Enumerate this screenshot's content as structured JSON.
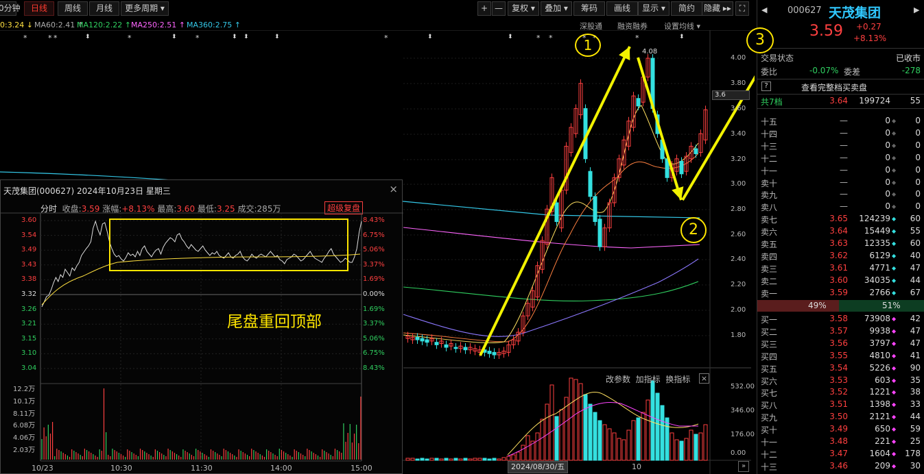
{
  "toolbar": {
    "left": [
      "0分钟",
      "日线",
      "周线",
      "月线",
      "更多周期 ▾"
    ],
    "right": [
      "+",
      "—",
      "复权 ▾",
      "叠加 ▾",
      "筹码",
      "画线",
      "显示 ▾",
      "简约",
      "隐藏 ▸▸"
    ]
  },
  "ma_line": [
    {
      "label": "0:3.24 ↓",
      "color": "#ffe040"
    },
    {
      "label": "MA60:2.41 ↑",
      "color": "#aaaaaa"
    },
    {
      "label": "MA120:2.22 ↑",
      "color": "#30d060"
    },
    {
      "label": "MA250:2.51 ↑",
      "color": "#ff66ff"
    },
    {
      "label": "MA360:2.75 ↑",
      "color": "#34c8e8"
    }
  ],
  "top_links": [
    "深股通",
    "融资融券",
    "设置均线 ▾"
  ],
  "main_chart": {
    "y_ticks": [
      "4.00",
      "3.80",
      "3.60",
      "3.40",
      "3.20",
      "3.00",
      "2.80",
      "2.60",
      "2.40",
      "2.20",
      "2.00",
      "1.80"
    ],
    "price_tag": "3.6",
    "high_label": "4.08",
    "date_label": "2024/08/30/五",
    "x_tick": "10",
    "annotations": [
      "1",
      "2",
      "3"
    ],
    "vol_header": [
      "改参数",
      "加指标",
      "换指标"
    ],
    "vol_ticks": [
      "532.00",
      "346.00",
      "176.00",
      "0.00"
    ]
  },
  "overlay": {
    "title": "天茂集团(000627) 2024年10月23日 星期三",
    "stats": {
      "label_fs": "分时",
      "close_k": "收盘:",
      "close_v": "3.59",
      "chg_k": "涨幅:",
      "chg_v": "+8.13%",
      "high_k": "最高:",
      "high_v": "3.60",
      "low_k": "最低:",
      "low_v": "3.25",
      "vol_k": "成交:",
      "vol_v": "285万"
    },
    "super": "超级复盘",
    "left_ticks": [
      "3.60",
      "3.54",
      "3.49",
      "3.43",
      "3.38",
      "3.32",
      "3.26",
      "3.21",
      "3.15",
      "3.10",
      "3.04"
    ],
    "right_ticks": [
      "8.43%",
      "6.75%",
      "5.06%",
      "3.37%",
      "1.69%",
      "0.00%",
      "1.69%",
      "3.37%",
      "5.06%",
      "6.75%",
      "8.43%"
    ],
    "vol_ticks": [
      "12.2万",
      "10.1万",
      "8.11万",
      "6.08万",
      "4.06万",
      "2.03万"
    ],
    "x_ticks": [
      "10/23",
      "10:30",
      "11:30",
      "14:00",
      "15:00"
    ],
    "annotation": "尾盘重回顶部",
    "close_icon": "×"
  },
  "orderbook": {
    "code": "000627",
    "name": "天茂集团",
    "price": "3.59",
    "change": "+0.27",
    "pct": "+8.13%",
    "status_k": "交易状态",
    "status_v": "已收市",
    "weibi_k": "委比",
    "weibi_v": "-0.07%",
    "weicha_k": "委差",
    "weicha_v": "-278",
    "full_link": "查看完整档买卖盘",
    "total": {
      "label": "共7档",
      "price": "3.64",
      "vol": "199724",
      "cnt": "55"
    },
    "sells": [
      {
        "label": "十五",
        "price": "—",
        "vol": "0",
        "cnt": "0"
      },
      {
        "label": "十四",
        "price": "—",
        "vol": "0",
        "cnt": "0"
      },
      {
        "label": "十三",
        "price": "—",
        "vol": "0",
        "cnt": "0"
      },
      {
        "label": "十二",
        "price": "—",
        "vol": "0",
        "cnt": "0"
      },
      {
        "label": "十一",
        "price": "—",
        "vol": "0",
        "cnt": "0"
      },
      {
        "label": "卖十",
        "price": "—",
        "vol": "0",
        "cnt": "0"
      },
      {
        "label": "卖九",
        "price": "—",
        "vol": "0",
        "cnt": "0"
      },
      {
        "label": "卖八",
        "price": "—",
        "vol": "0",
        "cnt": "0"
      },
      {
        "label": "卖七",
        "price": "3.65",
        "vol": "124239",
        "cnt": "60"
      },
      {
        "label": "卖六",
        "price": "3.64",
        "vol": "15449",
        "cnt": "55"
      },
      {
        "label": "卖五",
        "price": "3.63",
        "vol": "12335",
        "cnt": "60"
      },
      {
        "label": "卖四",
        "price": "3.62",
        "vol": "6129",
        "cnt": "40"
      },
      {
        "label": "卖三",
        "price": "3.61",
        "vol": "4771",
        "cnt": "47"
      },
      {
        "label": "卖二",
        "price": "3.60",
        "vol": "34035",
        "cnt": "44"
      },
      {
        "label": "卖一",
        "price": "3.59",
        "vol": "2766",
        "cnt": "67"
      }
    ],
    "ratio": {
      "left": "49%",
      "right": "51%"
    },
    "buys": [
      {
        "label": "买一",
        "price": "3.58",
        "vol": "73908",
        "cnt": "42"
      },
      {
        "label": "买二",
        "price": "3.57",
        "vol": "9938",
        "cnt": "47"
      },
      {
        "label": "买三",
        "price": "3.56",
        "vol": "3797",
        "cnt": "47"
      },
      {
        "label": "买四",
        "price": "3.55",
        "vol": "4810",
        "cnt": "41"
      },
      {
        "label": "买五",
        "price": "3.54",
        "vol": "5226",
        "cnt": "90"
      },
      {
        "label": "买六",
        "price": "3.53",
        "vol": "603",
        "cnt": "35"
      },
      {
        "label": "买七",
        "price": "3.52",
        "vol": "1221",
        "cnt": "38"
      },
      {
        "label": "买八",
        "price": "3.51",
        "vol": "1398",
        "cnt": "33"
      },
      {
        "label": "买九",
        "price": "3.50",
        "vol": "2121",
        "cnt": "44"
      },
      {
        "label": "买十",
        "price": "3.49",
        "vol": "650",
        "cnt": "59"
      },
      {
        "label": "十一",
        "price": "3.48",
        "vol": "221",
        "cnt": "25"
      },
      {
        "label": "十二",
        "price": "3.47",
        "vol": "1604",
        "cnt": "178"
      },
      {
        "label": "十三",
        "price": "3.46",
        "vol": "209",
        "cnt": "30"
      }
    ]
  }
}
